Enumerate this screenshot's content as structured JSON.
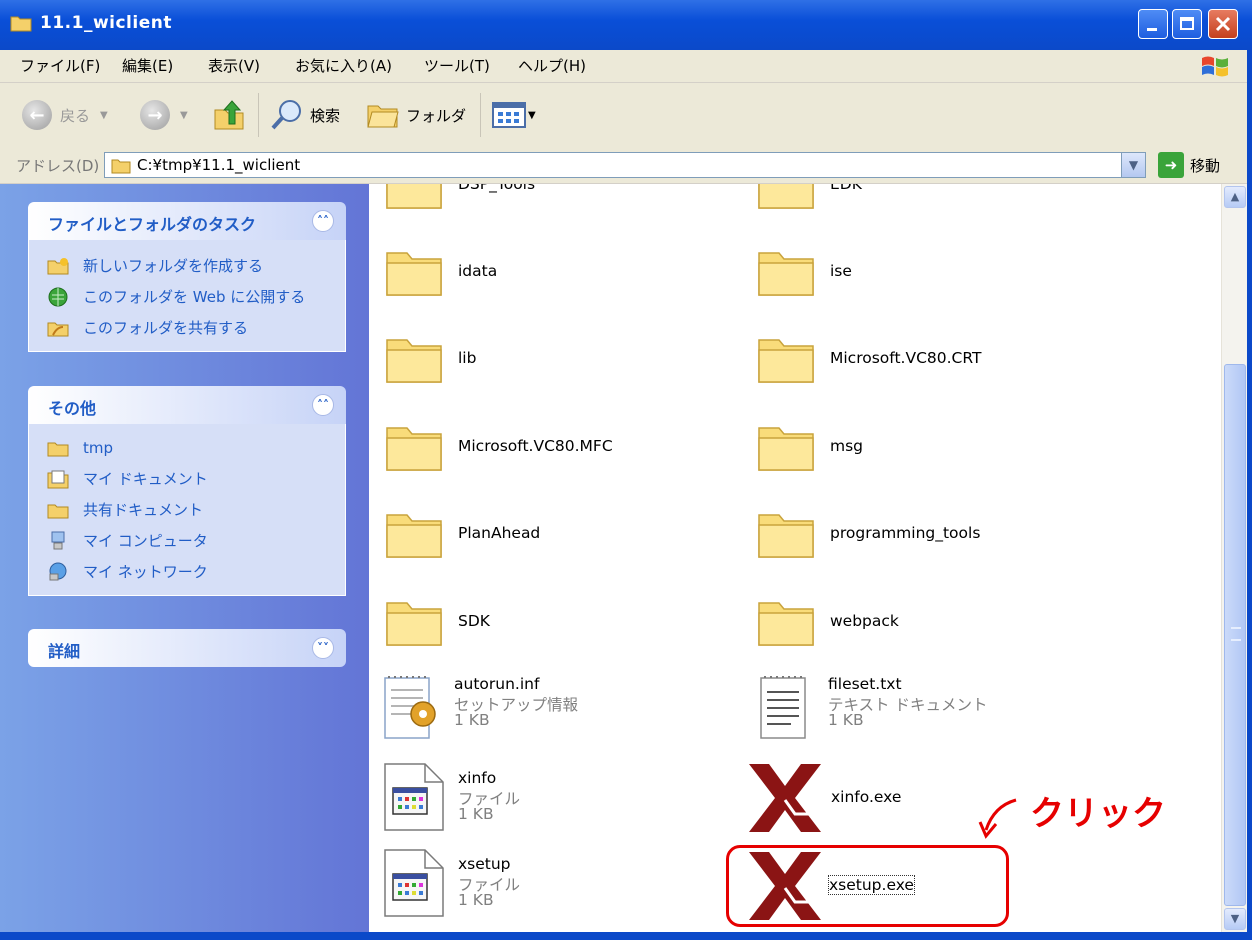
{
  "window": {
    "title": "11.1_wiclient"
  },
  "menu": {
    "items": [
      "ファイル(F)",
      "編集(E)",
      "表示(V)",
      "お気に入り(A)",
      "ツール(T)",
      "ヘルプ(H)"
    ]
  },
  "toolbar": {
    "back_label": "戻る",
    "search_label": "検索",
    "folders_label": "フォルダ"
  },
  "address": {
    "label": "アドレス(D)",
    "path": "C:¥tmp¥11.1_wiclient",
    "go_label": "移動"
  },
  "tasks": {
    "file_folder": {
      "title": "ファイルとフォルダのタスク",
      "items": [
        {
          "label": "新しいフォルダを作成する",
          "icon": "new-folder-icon"
        },
        {
          "label": "このフォルダを Web に公開する",
          "icon": "publish-web-icon"
        },
        {
          "label": "このフォルダを共有する",
          "icon": "share-folder-icon"
        }
      ]
    },
    "other": {
      "title": "その他",
      "items": [
        {
          "label": "tmp",
          "icon": "folder-icon"
        },
        {
          "label": "マイ ドキュメント",
          "icon": "my-documents-icon"
        },
        {
          "label": "共有ドキュメント",
          "icon": "folder-icon"
        },
        {
          "label": "マイ コンピュータ",
          "icon": "my-computer-icon"
        },
        {
          "label": "マイ ネットワーク",
          "icon": "my-network-icon"
        }
      ]
    },
    "details": {
      "title": "詳細"
    }
  },
  "files": [
    {
      "name": "DSP_Tools",
      "type": "folder"
    },
    {
      "name": "EDK",
      "type": "folder"
    },
    {
      "name": "idata",
      "type": "folder"
    },
    {
      "name": "ise",
      "type": "folder"
    },
    {
      "name": "lib",
      "type": "folder"
    },
    {
      "name": "Microsoft.VC80.CRT",
      "type": "folder"
    },
    {
      "name": "Microsoft.VC80.MFC",
      "type": "folder"
    },
    {
      "name": "msg",
      "type": "folder"
    },
    {
      "name": "PlanAhead",
      "type": "folder"
    },
    {
      "name": "programming_tools",
      "type": "folder"
    },
    {
      "name": "SDK",
      "type": "folder"
    },
    {
      "name": "webpack",
      "type": "folder"
    },
    {
      "name": "autorun.inf",
      "type": "setup-info",
      "kind": "セットアップ情報",
      "size": "1 KB"
    },
    {
      "name": "fileset.txt",
      "type": "text",
      "kind": "テキスト ドキュメント",
      "size": "1 KB"
    },
    {
      "name": "xinfo",
      "type": "file",
      "kind": "ファイル",
      "size": "1 KB"
    },
    {
      "name": "xinfo.exe",
      "type": "exe"
    },
    {
      "name": "xsetup",
      "type": "file",
      "kind": "ファイル",
      "size": "1 KB"
    },
    {
      "name": "xsetup.exe",
      "type": "exe"
    }
  ],
  "annotation": {
    "text": "クリック",
    "color": "#e60000"
  },
  "colors": {
    "titlebar": "#0b49c9",
    "task_link": "#215dc6",
    "xilinx_logo": "#8b1414"
  }
}
